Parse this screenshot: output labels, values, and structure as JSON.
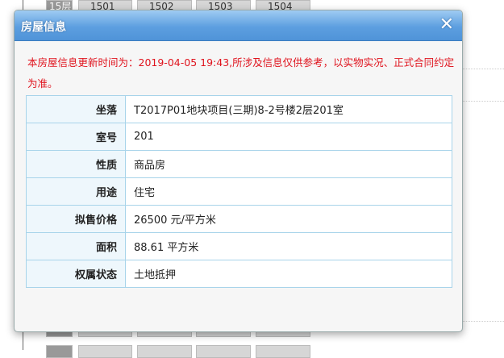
{
  "background": {
    "floor_label": "15层",
    "rooms": [
      "1501",
      "1502",
      "1503",
      "1504"
    ]
  },
  "dialog": {
    "title": "房屋信息",
    "close_icon": "close-x-icon",
    "notice": "本房屋信息更新时间为：2019-04-05 19:43,所涉及信息仅供参考，以实物实况、正式合同约定为准。",
    "notice_color": "#e0141e",
    "header_color": "#5d9fe0",
    "rows": [
      {
        "label": "坐落",
        "value": "T2017P01地块项目(三期)8-2号楼2层201室"
      },
      {
        "label": "室号",
        "value": "201"
      },
      {
        "label": "性质",
        "value": "商品房"
      },
      {
        "label": "用途",
        "value": "住宅"
      },
      {
        "label": "拟售价格",
        "value": "26500 元/平方米"
      },
      {
        "label": "面积",
        "value": "88.61 平方米"
      },
      {
        "label": "权属状态",
        "value": "土地抵押"
      }
    ]
  }
}
